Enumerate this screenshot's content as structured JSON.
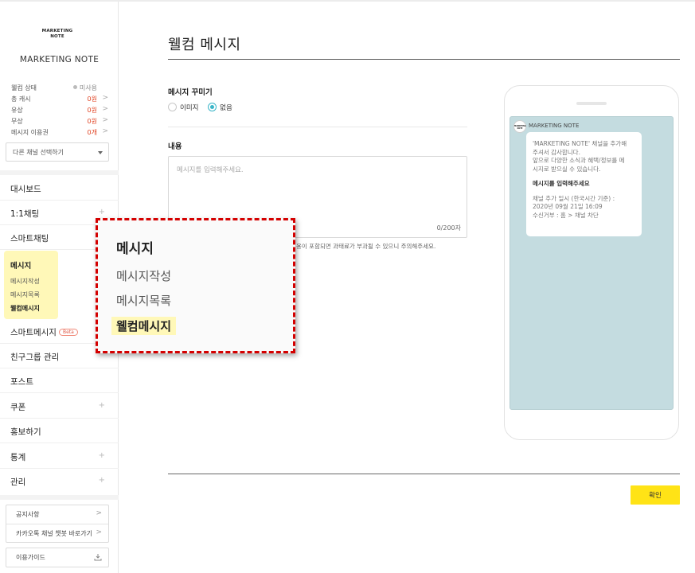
{
  "sidebar": {
    "logo_lines": [
      "MARKETING",
      "NOTE"
    ],
    "brand_name": "MARKETING NOTE",
    "info": [
      {
        "label": "웰컴 상태",
        "value": "미사용",
        "chevron": ""
      },
      {
        "label": "총 캐시",
        "value": "0원",
        "chevron": ">"
      },
      {
        "label": "유상",
        "value": "0원",
        "chevron": ">"
      },
      {
        "label": "무상",
        "value": "0원",
        "chevron": ">"
      },
      {
        "label": "메시지 이용권",
        "value": "0개",
        "chevron": ">"
      }
    ],
    "channel_select": "다른 채널 선택하기",
    "nav": {
      "dashboard": "대시보드",
      "chat": "1:1채팅",
      "smartchat": "스마트채팅",
      "smartmessage": "스마트메시지",
      "beta": "Beta",
      "friendgroup": "친구그룹 관리",
      "post": "포스트",
      "coupon": "쿠폰",
      "promote": "홍보하기",
      "stats": "통계",
      "manage": "관리",
      "plus": "+"
    },
    "message_group": {
      "header": "메시지",
      "items": [
        "메시지작성",
        "메시지목록",
        "웰컴메시지"
      ]
    },
    "bottom": {
      "notice": "공지사항",
      "kakao_link": "카카오톡 채널 챗봇 바로가기",
      "guide": "이용가이드",
      "chevron": ">"
    }
  },
  "main": {
    "title": "웰컴 메시지",
    "decorate_label": "메시지 꾸미기",
    "radio_image": "이미지",
    "radio_none": "없음",
    "content_label": "내용",
    "content_placeholder": "메시지를 입력해주세요.",
    "char_count": "0/200자",
    "notice_text": "용이 포함되면 과태료가 부과될 수 있으니 주의해주세요.",
    "confirm": "확인"
  },
  "preview": {
    "avatar_lines": [
      "MARKETING",
      "NOTE"
    ],
    "channel_name": "MARKETING NOTE",
    "line1": "'MARKETING NOTE' 채널을 추가해",
    "line2": "주셔서 감사합니다.",
    "line3": "앞으로 다양한 소식과 혜택/정보를 메",
    "line4": "시지로 받으실 수 있습니다.",
    "message": "메시지를 입력해주세요",
    "date_line1": "채널 추가 일시 (한국시간 기준) :",
    "date_line2": "2020년 09월 21일 16:09",
    "unsub": "수신거부 : 홈 > 채널 차단"
  },
  "colors": {
    "accent_yellow": "#ffe316",
    "highlight": "#fff8b8",
    "radio_teal": "#39b5c8",
    "warning_red": "#e0401f",
    "callout_border": "#d40000",
    "preview_bg": "#c4dce0"
  }
}
